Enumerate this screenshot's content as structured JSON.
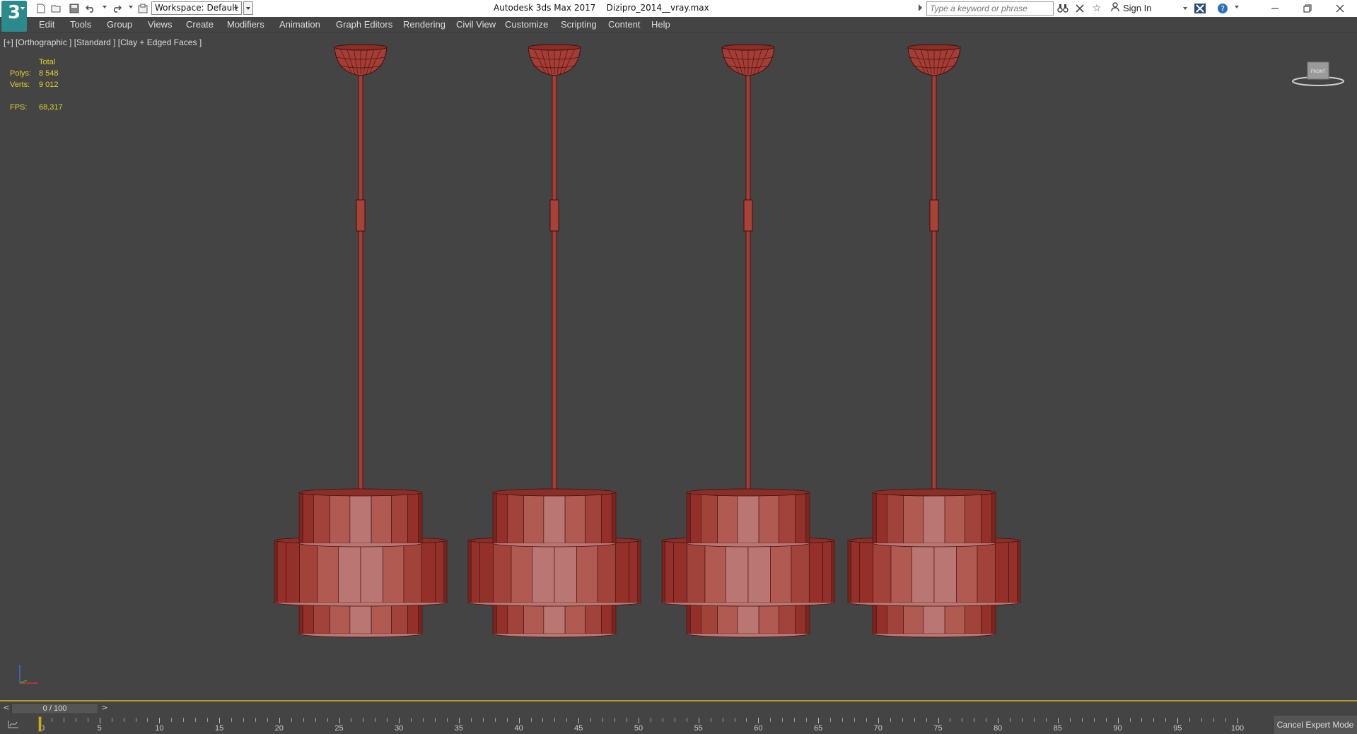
{
  "app": {
    "logo_text": "3",
    "title": "Autodesk 3ds Max 2017",
    "file_name": "Dizipro_2014__vray.max",
    "workspace_value": "Workspace: Default"
  },
  "quick_access": {
    "icons": [
      "new-file-icon",
      "open-file-icon",
      "save-icon",
      "undo-icon",
      "redo-icon",
      "project-folder-icon"
    ]
  },
  "infocenter": {
    "search_placeholder": "Type a keyword or phrase",
    "icons": [
      "binoculars-icon",
      "tools-icon",
      "star-icon",
      "autodesk-x-icon",
      "help-icon"
    ],
    "sign_in_label": "Sign In"
  },
  "window_controls": {
    "minimize": "—",
    "restore": "❐",
    "close": "✕"
  },
  "menu": {
    "items": [
      "Edit",
      "Tools",
      "Group",
      "Views",
      "Create",
      "Modifiers",
      "Animation",
      "Graph Editors",
      "Rendering",
      "Civil View",
      "Customize",
      "Scripting",
      "Content",
      "Help"
    ]
  },
  "viewport": {
    "label": "[+] [Orthographic ] [Standard ] [Clay + Edged Faces ]",
    "viewcube_label": "FRONT",
    "stats": {
      "total_label": "Total",
      "polys_label": "Polys:",
      "polys_value": "8 548",
      "verts_label": "Verts:",
      "verts_value": "9 012",
      "fps_label": "FPS:",
      "fps_value": "68,317"
    },
    "object_color": "#b0463c",
    "lamp_count": 4
  },
  "timeline": {
    "slider_text": "0 / 100",
    "left_arrow": "<",
    "right_arrow": ">",
    "frame_start": 0,
    "frame_end": 100,
    "current_frame": 0,
    "tick_labels": [
      "0",
      "5",
      "10",
      "15",
      "20",
      "25",
      "30",
      "35",
      "40",
      "45",
      "50",
      "55",
      "60",
      "65",
      "70",
      "75",
      "80",
      "85",
      "90",
      "95",
      "100"
    ]
  },
  "status": {
    "cancel_expert_mode": "Cancel Expert Mode"
  },
  "colors": {
    "ui_background": "#444444",
    "stats_text": "#e3d12a",
    "viewport_border": "#b69a2a",
    "logo_teal": "#2a8a8c"
  }
}
